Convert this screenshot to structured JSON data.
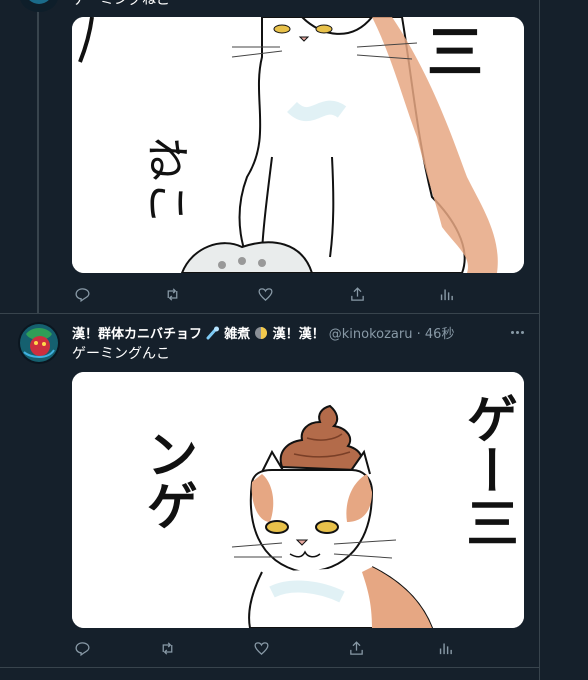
{
  "tweet_top": {
    "text_fragment": "ゲーミングねこ",
    "actions": [
      "reply-icon",
      "retweet-icon",
      "like-icon",
      "share-icon",
      "analytics-icon"
    ]
  },
  "tweet_main": {
    "display_name": "漢！群体カニバチョフ",
    "display_name_rest": "雑煮",
    "display_name_tail": "漢！漢！",
    "handle": "@kinokozaru",
    "separator": "·",
    "time": "46秒",
    "text": "ゲーミングんこ",
    "actions": [
      "reply-icon",
      "retweet-icon",
      "like-icon",
      "share-icon",
      "analytics-icon"
    ]
  },
  "artwork": {
    "top_chars_right": "三",
    "top_chars_left": "ねこ",
    "main_chars_right": "ゲー三",
    "main_chars_left": "ンゲ"
  },
  "colors": {
    "background": "#15202b",
    "border": "#38444d",
    "secondary_text": "#8899a6"
  }
}
